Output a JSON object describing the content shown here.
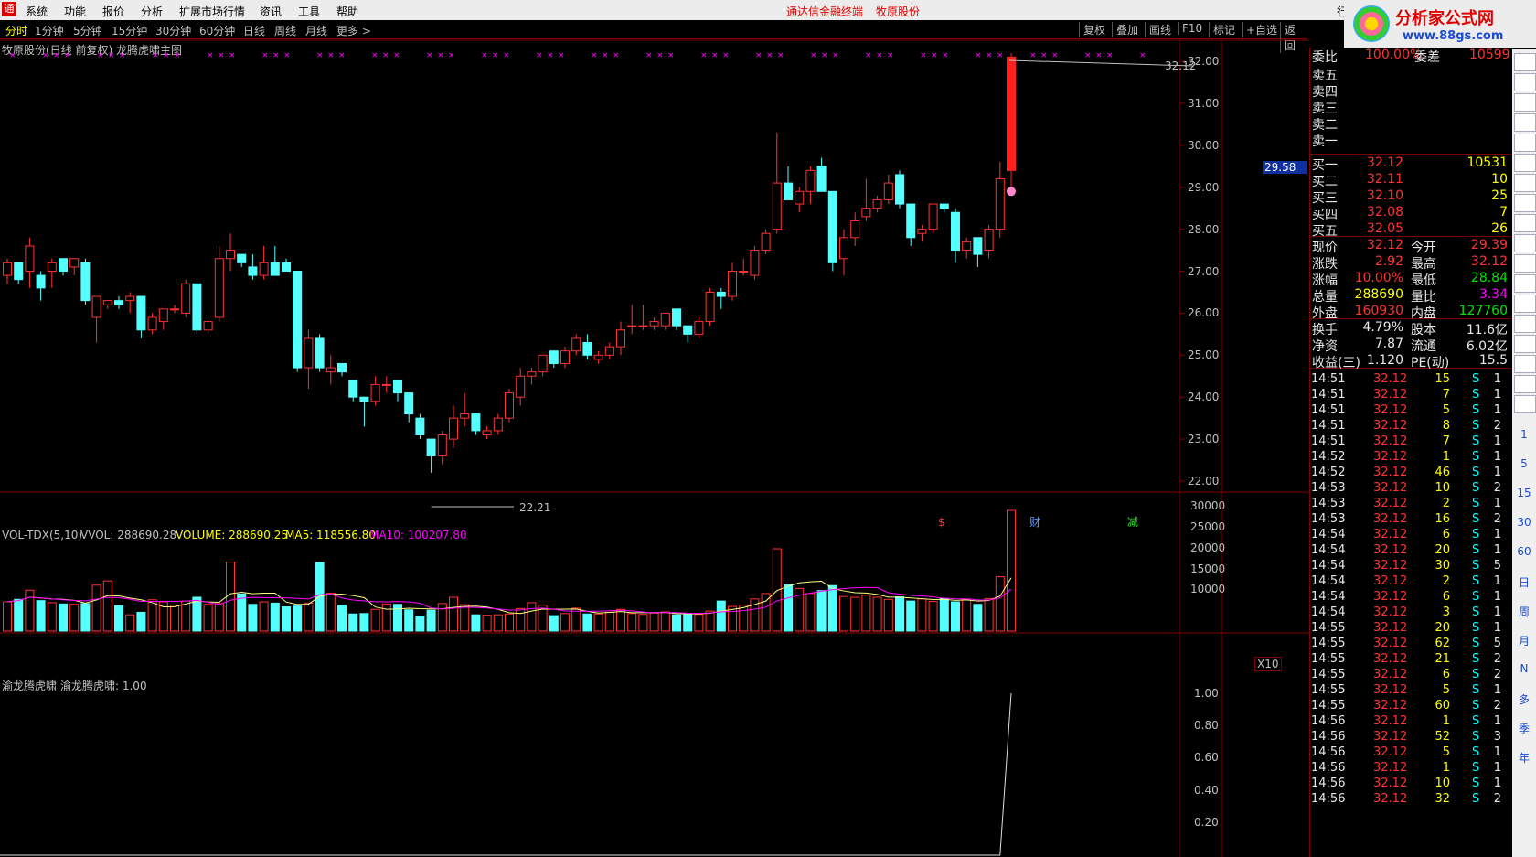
{
  "menu": {
    "logo": "通",
    "items": [
      "系统",
      "功能",
      "报价",
      "分析",
      "扩展市场行情",
      "资讯",
      "工具",
      "帮助"
    ],
    "center_left": "通达信金融终端",
    "center_right": "牧原股份",
    "corner": "行"
  },
  "watermark": {
    "line1": "分析家公式网",
    "line2": "www.88gs.com"
  },
  "toolbar": {
    "items": [
      "分时",
      "1分钟",
      "5分钟",
      "15分钟",
      "30分钟",
      "60分钟",
      "日线",
      "周线",
      "月线",
      "更多 >"
    ],
    "active": "分时",
    "right": [
      "复权",
      "叠加",
      "画线",
      "F10",
      "标记",
      "+自选",
      "返回"
    ]
  },
  "chart_title": "牧原股份(日线 前复权) 龙腾虎啸主图",
  "price_axis": [
    "32.00",
    "31.00",
    "30.00",
    "29.00",
    "28.00",
    "27.00",
    "26.00",
    "25.00",
    "24.00",
    "23.00",
    "22.00"
  ],
  "current_price_tag": "29.58",
  "high_label": "32.12",
  "low_label": "22.21",
  "events": [
    "$",
    "财",
    "减"
  ],
  "vol_indicator": {
    "name": "VOL-TDX(5,10)",
    "vvol": "VVOL: 288690.28",
    "volume": "VOLUME: 288690.25",
    "ma5": "MA5: 118556.80",
    "ma10": "MA10: 100207.80"
  },
  "vol_axis": [
    "30000",
    "25000",
    "20000",
    "15000",
    "10000"
  ],
  "vol_unit": "X10",
  "sub_indicator": {
    "name": "渝龙腾虎啸",
    "value": "渝龙腾虎啸: 1.00"
  },
  "sub_axis": [
    "1.00",
    "0.80",
    "0.60",
    "0.40",
    "0.20"
  ],
  "chart_data": {
    "type": "candlestick",
    "ylim": [
      22.0,
      32.3
    ],
    "candles": [
      [
        26.9,
        27.3,
        26.7,
        27.2
      ],
      [
        27.2,
        27.2,
        26.7,
        26.8
      ],
      [
        27.0,
        27.8,
        26.6,
        27.6
      ],
      [
        26.9,
        27.0,
        26.3,
        26.6
      ],
      [
        27.0,
        27.3,
        26.6,
        27.2
      ],
      [
        27.3,
        27.3,
        26.9,
        27.0
      ],
      [
        27.1,
        27.3,
        26.9,
        27.3
      ],
      [
        27.2,
        27.3,
        26.2,
        26.3
      ],
      [
        25.9,
        26.4,
        25.3,
        26.4
      ],
      [
        26.2,
        26.3,
        26.1,
        26.3
      ],
      [
        26.3,
        26.4,
        26.1,
        26.2
      ],
      [
        26.3,
        26.5,
        26.0,
        26.4
      ],
      [
        26.4,
        26.4,
        25.4,
        25.6
      ],
      [
        25.6,
        26.0,
        25.5,
        25.9
      ],
      [
        25.8,
        26.1,
        25.6,
        26.1
      ],
      [
        26.1,
        26.2,
        26.0,
        26.1
      ],
      [
        26.0,
        26.8,
        25.9,
        26.7
      ],
      [
        26.7,
        26.7,
        25.5,
        25.6
      ],
      [
        25.6,
        25.9,
        25.5,
        25.8
      ],
      [
        25.9,
        27.6,
        25.8,
        27.3
      ],
      [
        27.3,
        27.9,
        27.0,
        27.5
      ],
      [
        27.4,
        27.4,
        27.1,
        27.2
      ],
      [
        27.1,
        27.4,
        26.8,
        26.9
      ],
      [
        26.9,
        27.6,
        26.8,
        27.2
      ],
      [
        27.2,
        27.6,
        26.9,
        26.9
      ],
      [
        27.2,
        27.3,
        27.0,
        27.0
      ],
      [
        27.0,
        27.0,
        24.6,
        24.7
      ],
      [
        24.7,
        25.6,
        24.2,
        25.4
      ],
      [
        25.4,
        25.5,
        24.6,
        24.7
      ],
      [
        24.6,
        25.0,
        24.3,
        24.7
      ],
      [
        24.8,
        24.8,
        24.5,
        24.6
      ],
      [
        24.4,
        24.4,
        23.9,
        24.0
      ],
      [
        24.0,
        24.0,
        23.3,
        23.9
      ],
      [
        23.9,
        24.5,
        23.8,
        24.3
      ],
      [
        24.3,
        24.5,
        24.1,
        24.3
      ],
      [
        24.4,
        24.4,
        23.9,
        24.1
      ],
      [
        24.1,
        24.1,
        23.4,
        23.6
      ],
      [
        23.5,
        23.6,
        23.0,
        23.1
      ],
      [
        23.0,
        23.0,
        22.2,
        22.6
      ],
      [
        22.6,
        23.2,
        22.4,
        23.1
      ],
      [
        23.0,
        23.8,
        22.8,
        23.5
      ],
      [
        23.5,
        24.1,
        23.3,
        23.6
      ],
      [
        23.6,
        23.6,
        23.1,
        23.2
      ],
      [
        23.1,
        23.3,
        23.0,
        23.2
      ],
      [
        23.2,
        23.6,
        23.1,
        23.5
      ],
      [
        23.5,
        24.2,
        23.4,
        24.1
      ],
      [
        24.0,
        24.7,
        23.8,
        24.5
      ],
      [
        24.5,
        24.7,
        24.3,
        24.6
      ],
      [
        24.6,
        25.0,
        24.5,
        25.0
      ],
      [
        25.1,
        25.1,
        24.7,
        24.8
      ],
      [
        24.8,
        25.2,
        24.7,
        25.1
      ],
      [
        25.1,
        25.5,
        25.0,
        25.4
      ],
      [
        25.3,
        25.5,
        24.9,
        25.0
      ],
      [
        24.9,
        25.1,
        24.8,
        25.0
      ],
      [
        25.0,
        25.3,
        24.9,
        25.2
      ],
      [
        25.2,
        25.8,
        25.0,
        25.6
      ],
      [
        25.7,
        26.2,
        25.5,
        25.7
      ],
      [
        25.7,
        26.2,
        25.6,
        25.7
      ],
      [
        25.7,
        25.9,
        25.6,
        25.8
      ],
      [
        25.7,
        26.0,
        25.6,
        26.0
      ],
      [
        26.1,
        26.1,
        25.6,
        25.7
      ],
      [
        25.7,
        25.7,
        25.3,
        25.5
      ],
      [
        25.5,
        25.9,
        25.4,
        25.8
      ],
      [
        25.8,
        26.6,
        25.7,
        26.5
      ],
      [
        26.5,
        26.6,
        26.1,
        26.4
      ],
      [
        26.4,
        27.2,
        26.3,
        27.0
      ],
      [
        27.0,
        27.3,
        26.9,
        27.0
      ],
      [
        26.9,
        27.6,
        26.8,
        27.5
      ],
      [
        27.5,
        28.0,
        27.4,
        27.9
      ],
      [
        28.0,
        30.3,
        27.9,
        29.1
      ],
      [
        29.1,
        29.5,
        28.7,
        28.7
      ],
      [
        28.6,
        29.0,
        28.4,
        28.9
      ],
      [
        28.9,
        29.5,
        28.6,
        29.4
      ],
      [
        29.5,
        29.7,
        29.2,
        28.9
      ],
      [
        28.9,
        28.9,
        27.0,
        27.2
      ],
      [
        27.3,
        28.0,
        26.9,
        27.8
      ],
      [
        27.8,
        28.4,
        27.6,
        28.2
      ],
      [
        28.3,
        29.2,
        28.2,
        28.5
      ],
      [
        28.5,
        28.8,
        28.4,
        28.7
      ],
      [
        28.7,
        29.3,
        28.6,
        29.1
      ],
      [
        29.3,
        29.4,
        28.5,
        28.6
      ],
      [
        28.6,
        28.6,
        27.6,
        27.8
      ],
      [
        27.9,
        28.1,
        27.7,
        28.0
      ],
      [
        28.0,
        28.6,
        27.9,
        28.6
      ],
      [
        28.6,
        28.6,
        28.4,
        28.5
      ],
      [
        28.4,
        28.5,
        27.2,
        27.5
      ],
      [
        27.5,
        27.8,
        27.3,
        27.7
      ],
      [
        27.8,
        27.8,
        27.1,
        27.4
      ],
      [
        27.5,
        28.1,
        27.3,
        28.0
      ],
      [
        28.0,
        29.6,
        27.8,
        29.2
      ],
      [
        29.4,
        32.2,
        28.8,
        32.1
      ]
    ],
    "volumes": [
      7000,
      7600,
      9800,
      7300,
      6800,
      6500,
      6400,
      6600,
      11000,
      12000,
      6100,
      3900,
      4500,
      7500,
      7000,
      6200,
      7200,
      8100,
      6400,
      6600,
      16500,
      8900,
      6400,
      7000,
      6700,
      5800,
      6000,
      6700,
      16400,
      9100,
      6200,
      4100,
      4200,
      5200,
      6500,
      6400,
      5100,
      3600,
      5000,
      6600,
      8100,
      6300,
      3900,
      3800,
      3900,
      4100,
      5400,
      6800,
      6200,
      3700,
      4200,
      5500,
      4100,
      4100,
      4500,
      5200,
      4200,
      4000,
      4300,
      4600,
      3900,
      4000,
      4000,
      4800,
      7200,
      5900,
      6200,
      7700,
      9000,
      19700,
      11100,
      10200,
      9000,
      9700,
      10900,
      8300,
      8100,
      8600,
      8100,
      7600,
      8200,
      7200,
      7700,
      7100,
      7800,
      7000,
      7700,
      6400,
      7800,
      13000,
      28900
    ]
  },
  "quote": {
    "weibi": {
      "label": "委比",
      "value": "100.00%",
      "label2": "委差",
      "value2": "10599"
    },
    "sell": [
      {
        "label": "卖五"
      },
      {
        "label": "卖四"
      },
      {
        "label": "卖三"
      },
      {
        "label": "卖二"
      },
      {
        "label": "卖一"
      }
    ],
    "buy": [
      {
        "label": "买一",
        "price": "32.12",
        "vol": "10531"
      },
      {
        "label": "买二",
        "price": "32.11",
        "vol": "10"
      },
      {
        "label": "买三",
        "price": "32.10",
        "vol": "25"
      },
      {
        "label": "买四",
        "price": "32.08",
        "vol": "7"
      },
      {
        "label": "买五",
        "price": "32.05",
        "vol": "26"
      }
    ],
    "stats": [
      {
        "l1": "现价",
        "v1": "32.12",
        "c1": "red",
        "l2": "今开",
        "v2": "29.39",
        "c2": "red"
      },
      {
        "l1": "涨跌",
        "v1": "2.92",
        "c1": "red",
        "l2": "最高",
        "v2": "32.12",
        "c2": "red"
      },
      {
        "l1": "涨幅",
        "v1": "10.00%",
        "c1": "red",
        "l2": "最低",
        "v2": "28.84",
        "c2": "grn"
      },
      {
        "l1": "总量",
        "v1": "288690",
        "c1": "yel",
        "l2": "量比",
        "v2": "3.34",
        "c2": "mag"
      },
      {
        "l1": "外盘",
        "v1": "160930",
        "c1": "red",
        "l2": "内盘",
        "v2": "127760",
        "c2": "grn"
      },
      {
        "l1": "换手",
        "v1": "4.79%",
        "c1": "wht",
        "l2": "股本",
        "v2": "11.6亿",
        "c2": "wht"
      },
      {
        "l1": "净资",
        "v1": "7.87",
        "c1": "wht",
        "l2": "流通",
        "v2": "6.02亿",
        "c2": "wht"
      },
      {
        "l1": "收益(三)",
        "v1": "1.120",
        "c1": "wht",
        "l2": "PE(动)",
        "v2": "15.5",
        "c2": "wht"
      }
    ]
  },
  "ticks": [
    [
      "14:51",
      "32.12",
      "15",
      "S",
      "1"
    ],
    [
      "14:51",
      "32.12",
      "7",
      "S",
      "1"
    ],
    [
      "14:51",
      "32.12",
      "5",
      "S",
      "1"
    ],
    [
      "14:51",
      "32.12",
      "8",
      "S",
      "2"
    ],
    [
      "14:51",
      "32.12",
      "7",
      "S",
      "1"
    ],
    [
      "14:52",
      "32.12",
      "1",
      "S",
      "1"
    ],
    [
      "14:52",
      "32.12",
      "46",
      "S",
      "1"
    ],
    [
      "14:53",
      "32.12",
      "10",
      "S",
      "2"
    ],
    [
      "14:53",
      "32.12",
      "2",
      "S",
      "1"
    ],
    [
      "14:53",
      "32.12",
      "16",
      "S",
      "2"
    ],
    [
      "14:54",
      "32.12",
      "6",
      "S",
      "1"
    ],
    [
      "14:54",
      "32.12",
      "20",
      "S",
      "1"
    ],
    [
      "14:54",
      "32.12",
      "30",
      "S",
      "5"
    ],
    [
      "14:54",
      "32.12",
      "2",
      "S",
      "1"
    ],
    [
      "14:54",
      "32.12",
      "6",
      "S",
      "1"
    ],
    [
      "14:54",
      "32.12",
      "3",
      "S",
      "1"
    ],
    [
      "14:55",
      "32.12",
      "20",
      "S",
      "1"
    ],
    [
      "14:55",
      "32.12",
      "62",
      "S",
      "5"
    ],
    [
      "14:55",
      "32.12",
      "21",
      "S",
      "2"
    ],
    [
      "14:55",
      "32.12",
      "6",
      "S",
      "2"
    ],
    [
      "14:55",
      "32.12",
      "5",
      "S",
      "1"
    ],
    [
      "14:55",
      "32.12",
      "60",
      "S",
      "2"
    ],
    [
      "14:56",
      "32.12",
      "1",
      "S",
      "1"
    ],
    [
      "14:56",
      "32.12",
      "52",
      "S",
      "3"
    ],
    [
      "14:56",
      "32.12",
      "5",
      "S",
      "1"
    ],
    [
      "14:56",
      "32.12",
      "1",
      "S",
      "1"
    ],
    [
      "14:56",
      "32.12",
      "10",
      "S",
      "1"
    ],
    [
      "14:56",
      "32.12",
      "32",
      "S",
      "2"
    ]
  ],
  "side_buttons": [
    "1",
    "5",
    "15",
    "30",
    "60",
    "日",
    "周",
    "月",
    "N",
    "多",
    "季",
    "年"
  ]
}
